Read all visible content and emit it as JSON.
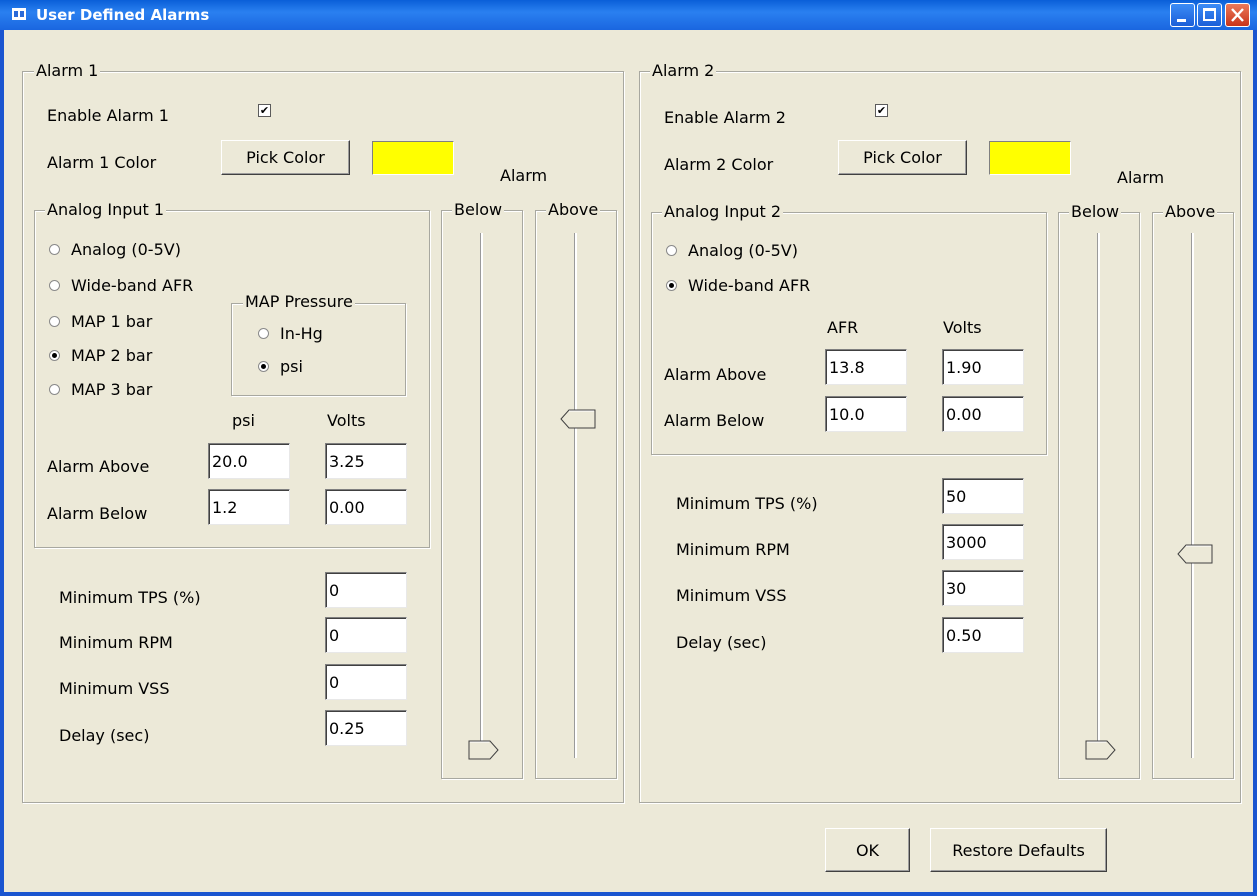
{
  "window": {
    "title": "User Defined Alarms"
  },
  "alarm1": {
    "group_label": "Alarm 1",
    "enable_label": "Enable Alarm 1",
    "enable_checked": true,
    "color_label": "Alarm 1 Color",
    "pick_color_label": "Pick Color",
    "color": "#ffff00",
    "analog_group_label": "Analog Input 1",
    "inputs": [
      "Analog (0-5V)",
      "Wide-band AFR",
      "MAP 1 bar",
      "MAP 2 bar",
      "MAP 3 bar"
    ],
    "selected_input": "MAP 2 bar",
    "map_pressure": {
      "label": "MAP Pressure",
      "options": [
        "In-Hg",
        "psi"
      ],
      "selected": "psi"
    },
    "col_unit": "psi",
    "col_volts": "Volts",
    "alarm_above_label": "Alarm Above",
    "alarm_below_label": "Alarm Below",
    "alarm_above_unit": "20.0",
    "alarm_above_volts": "3.25",
    "alarm_below_unit": "1.2",
    "alarm_below_volts": "0.00",
    "min_tps_label": "Minimum TPS (%)",
    "min_rpm_label": "Minimum RPM",
    "min_vss_label": "Minimum VSS",
    "delay_label": "Delay (sec)",
    "min_tps": "0",
    "min_rpm": "0",
    "min_vss": "0",
    "delay": "0.25",
    "slider_title": "Alarm",
    "below_label": "Below",
    "above_label": "Above",
    "below_level": 0.0,
    "above_level": 0.64
  },
  "alarm2": {
    "group_label": "Alarm 2",
    "enable_label": "Enable Alarm 2",
    "enable_checked": true,
    "color_label": "Alarm 2 Color",
    "pick_color_label": "Pick Color",
    "color": "#ffff00",
    "analog_group_label": "Analog Input 2",
    "inputs": [
      "Analog (0-5V)",
      "Wide-band AFR"
    ],
    "selected_input": "Wide-band AFR",
    "col_unit": "AFR",
    "col_volts": "Volts",
    "alarm_above_label": "Alarm Above",
    "alarm_below_label": "Alarm Below",
    "alarm_above_unit": "13.8",
    "alarm_above_volts": "1.90",
    "alarm_below_unit": "10.0",
    "alarm_below_volts": "0.00",
    "min_tps_label": "Minimum TPS (%)",
    "min_rpm_label": "Minimum RPM",
    "min_vss_label": "Minimum VSS",
    "delay_label": "Delay (sec)",
    "min_tps": "50",
    "min_rpm": "3000",
    "min_vss": "30",
    "delay": "0.50",
    "slider_title": "Alarm",
    "below_label": "Below",
    "above_label": "Above",
    "below_level": 0.0,
    "above_level": 0.38
  },
  "buttons": {
    "ok": "OK",
    "restore": "Restore Defaults"
  }
}
